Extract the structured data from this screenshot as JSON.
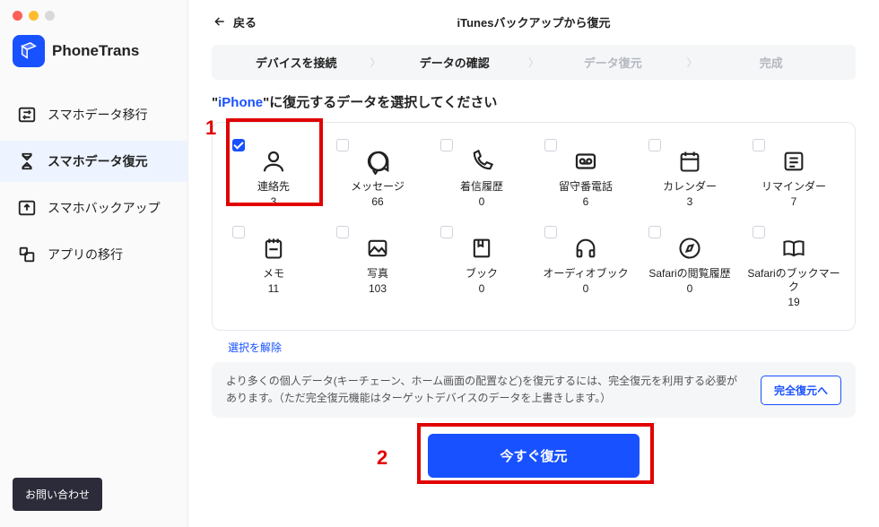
{
  "brand": {
    "name": "PhoneTrans"
  },
  "sidebar": {
    "items": [
      {
        "label": "スマホデータ移行"
      },
      {
        "label": "スマホデータ復元"
      },
      {
        "label": "スマホバックアップ"
      },
      {
        "label": "アプリの移行"
      }
    ],
    "contact": "お問い合わせ"
  },
  "header": {
    "back": "戻る",
    "title": "iTunesバックアップから復元"
  },
  "steps": {
    "s1": "デバイスを接続",
    "s2": "データの確認",
    "s3": "データ復元",
    "s4": "完成"
  },
  "page": {
    "heading_prefix": "\"",
    "heading_device": "iPhone",
    "heading_suffix": "\"に復元するデータを選択してください",
    "deselect": "選択を解除",
    "notice": "より多くの個人データ(キーチェーン、ホーム画面の配置など)を復元するには、完全復元を利用する必要があります。（ただ完全復元機能はターゲットデバイスのデータを上書きします。）",
    "full_restore": "完全復元へ",
    "primary": "今すぐ復元"
  },
  "cells": [
    {
      "label": "連絡先",
      "count": "3",
      "checked": true
    },
    {
      "label": "メッセージ",
      "count": "66",
      "checked": false
    },
    {
      "label": "着信履歴",
      "count": "0",
      "checked": false
    },
    {
      "label": "留守番電話",
      "count": "6",
      "checked": false
    },
    {
      "label": "カレンダー",
      "count": "3",
      "checked": false
    },
    {
      "label": "リマインダー",
      "count": "7",
      "checked": false
    },
    {
      "label": "メモ",
      "count": "11",
      "checked": false
    },
    {
      "label": "写真",
      "count": "103",
      "checked": false
    },
    {
      "label": "ブック",
      "count": "0",
      "checked": false
    },
    {
      "label": "オーディオブック",
      "count": "0",
      "checked": false
    },
    {
      "label": "Safariの閲覧履歴",
      "count": "0",
      "checked": false
    },
    {
      "label": "Safariのブックマーク",
      "count": "19",
      "checked": false
    }
  ],
  "annotations": {
    "a1": "1",
    "a2": "2"
  }
}
